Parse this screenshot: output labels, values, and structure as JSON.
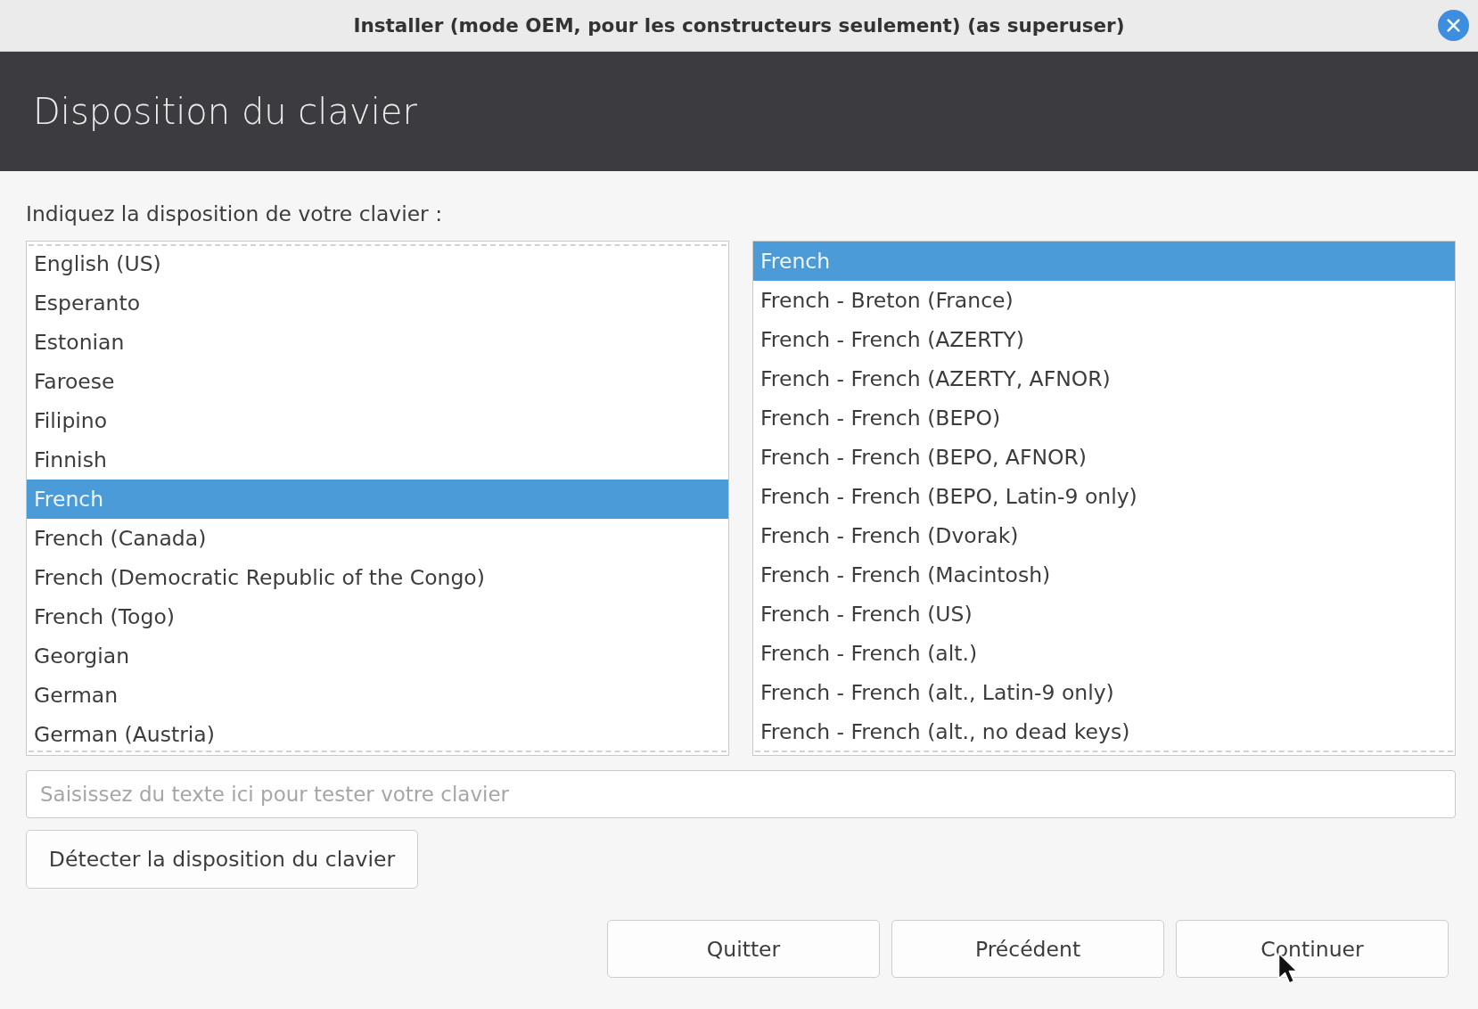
{
  "window": {
    "title": "Installer (mode OEM, pour les constructeurs seulement) (as superuser)"
  },
  "header": {
    "title": "Disposition du clavier"
  },
  "prompt": "Indiquez la disposition de votre clavier :",
  "layouts": {
    "more_above": true,
    "more_below": true,
    "items": [
      {
        "label": "English (US)",
        "selected": false
      },
      {
        "label": "Esperanto",
        "selected": false
      },
      {
        "label": "Estonian",
        "selected": false
      },
      {
        "label": "Faroese",
        "selected": false
      },
      {
        "label": "Filipino",
        "selected": false
      },
      {
        "label": "Finnish",
        "selected": false
      },
      {
        "label": "French",
        "selected": true
      },
      {
        "label": "French (Canada)",
        "selected": false
      },
      {
        "label": "French (Democratic Republic of the Congo)",
        "selected": false
      },
      {
        "label": "French (Togo)",
        "selected": false
      },
      {
        "label": "Georgian",
        "selected": false
      },
      {
        "label": "German",
        "selected": false
      },
      {
        "label": "German (Austria)",
        "selected": false
      }
    ]
  },
  "variants": {
    "more_above": false,
    "more_below": true,
    "items": [
      {
        "label": "French",
        "selected": true
      },
      {
        "label": "French - Breton (France)",
        "selected": false
      },
      {
        "label": "French - French (AZERTY)",
        "selected": false
      },
      {
        "label": "French - French (AZERTY, AFNOR)",
        "selected": false
      },
      {
        "label": "French - French (BEPO)",
        "selected": false
      },
      {
        "label": "French - French (BEPO, AFNOR)",
        "selected": false
      },
      {
        "label": "French - French (BEPO, Latin-9 only)",
        "selected": false
      },
      {
        "label": "French - French (Dvorak)",
        "selected": false
      },
      {
        "label": "French - French (Macintosh)",
        "selected": false
      },
      {
        "label": "French - French (US)",
        "selected": false
      },
      {
        "label": "French - French (alt.)",
        "selected": false
      },
      {
        "label": "French - French (alt., Latin-9 only)",
        "selected": false
      },
      {
        "label": "French - French (alt., no dead keys)",
        "selected": false
      }
    ]
  },
  "test_field": {
    "placeholder": "Saisissez du texte ici pour tester votre clavier"
  },
  "detect_button": "Détecter la disposition du clavier",
  "buttons": [
    "Quitter",
    "Précédent",
    "Continuer"
  ]
}
